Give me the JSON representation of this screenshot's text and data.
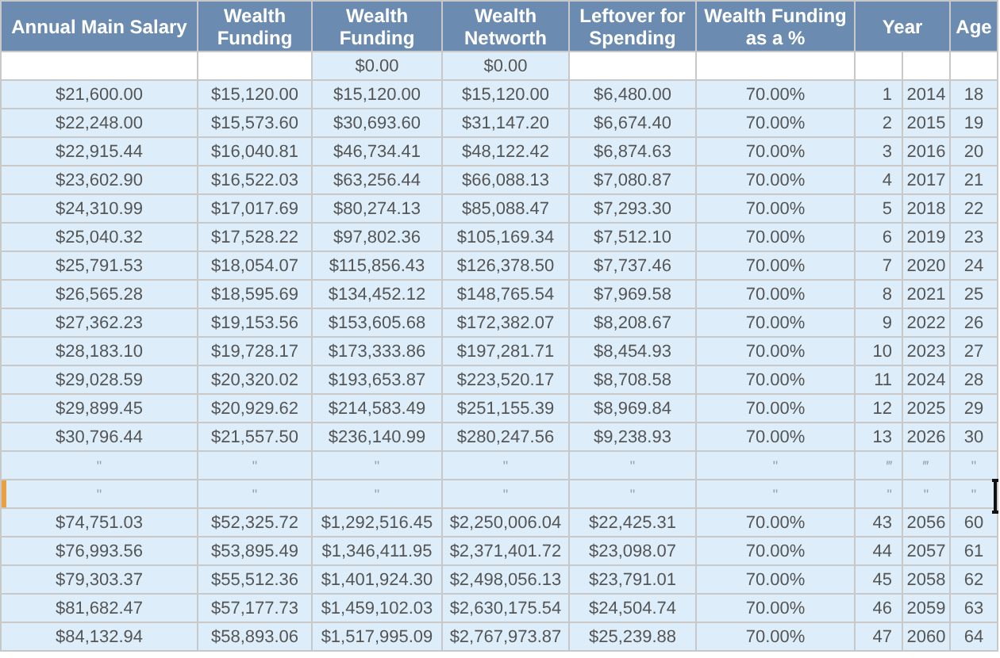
{
  "columns": [
    {
      "label": "Annual Main Salary",
      "kind": "single"
    },
    {
      "label": "Wealth Funding",
      "kind": "single"
    },
    {
      "label": "Wealth Funding",
      "kind": "single"
    },
    {
      "label": "Wealth Networth",
      "kind": "single"
    },
    {
      "label": "Leftover for Spending",
      "kind": "single"
    },
    {
      "label": "Wealth Funding as a %",
      "kind": "single"
    },
    {
      "label": "Year",
      "kind": "double"
    },
    {
      "label": "Age",
      "kind": "single"
    }
  ],
  "opening": {
    "wealth_funding": "$0.00",
    "wealth_networth": "$0.00"
  },
  "rows": [
    {
      "kind": "data",
      "selected": false,
      "cells": [
        "$21,600.00",
        "$15,120.00",
        "$15,120.00",
        "$15,120.00",
        "$6,480.00",
        "70.00%",
        "1",
        "2014",
        "18"
      ]
    },
    {
      "kind": "data",
      "selected": false,
      "cells": [
        "$22,248.00",
        "$15,573.60",
        "$30,693.60",
        "$31,147.20",
        "$6,674.40",
        "70.00%",
        "2",
        "2015",
        "19"
      ]
    },
    {
      "kind": "data",
      "selected": false,
      "cells": [
        "$22,915.44",
        "$16,040.81",
        "$46,734.41",
        "$48,122.42",
        "$6,874.63",
        "70.00%",
        "3",
        "2016",
        "20"
      ]
    },
    {
      "kind": "data",
      "selected": false,
      "cells": [
        "$23,602.90",
        "$16,522.03",
        "$63,256.44",
        "$66,088.13",
        "$7,080.87",
        "70.00%",
        "4",
        "2017",
        "21"
      ]
    },
    {
      "kind": "data",
      "selected": false,
      "cells": [
        "$24,310.99",
        "$17,017.69",
        "$80,274.13",
        "$85,088.47",
        "$7,293.30",
        "70.00%",
        "5",
        "2018",
        "22"
      ]
    },
    {
      "kind": "data",
      "selected": false,
      "cells": [
        "$25,040.32",
        "$17,528.22",
        "$97,802.36",
        "$105,169.34",
        "$7,512.10",
        "70.00%",
        "6",
        "2019",
        "23"
      ]
    },
    {
      "kind": "data",
      "selected": false,
      "cells": [
        "$25,791.53",
        "$18,054.07",
        "$115,856.43",
        "$126,378.50",
        "$7,737.46",
        "70.00%",
        "7",
        "2020",
        "24"
      ]
    },
    {
      "kind": "data",
      "selected": false,
      "cells": [
        "$26,565.28",
        "$18,595.69",
        "$134,452.12",
        "$148,765.54",
        "$7,969.58",
        "70.00%",
        "8",
        "2021",
        "25"
      ]
    },
    {
      "kind": "data",
      "selected": false,
      "cells": [
        "$27,362.23",
        "$19,153.56",
        "$153,605.68",
        "$172,382.07",
        "$8,208.67",
        "70.00%",
        "9",
        "2022",
        "26"
      ]
    },
    {
      "kind": "data",
      "selected": false,
      "cells": [
        "$28,183.10",
        "$19,728.17",
        "$173,333.86",
        "$197,281.71",
        "$8,454.93",
        "70.00%",
        "10",
        "2023",
        "27"
      ]
    },
    {
      "kind": "data",
      "selected": false,
      "cells": [
        "$29,028.59",
        "$20,320.02",
        "$193,653.87",
        "$223,520.17",
        "$8,708.58",
        "70.00%",
        "11",
        "2024",
        "28"
      ]
    },
    {
      "kind": "data",
      "selected": false,
      "cells": [
        "$29,899.45",
        "$20,929.62",
        "$214,583.49",
        "$251,155.39",
        "$8,969.84",
        "70.00%",
        "12",
        "2025",
        "29"
      ]
    },
    {
      "kind": "data",
      "selected": false,
      "cells": [
        "$30,796.44",
        "$21,557.50",
        "$236,140.99",
        "$280,247.56",
        "$9,238.93",
        "70.00%",
        "13",
        "2026",
        "30"
      ]
    },
    {
      "kind": "ditto",
      "selected": false,
      "cells": [
        "\"",
        "\"",
        "\"",
        "\"",
        "\"",
        "\"",
        "‴",
        "‴",
        "\""
      ]
    },
    {
      "kind": "ditto",
      "selected": true,
      "cells": [
        "\"",
        "\"",
        "\"",
        "\"",
        "\"",
        "\"",
        "\"",
        "\"",
        "\""
      ]
    },
    {
      "kind": "data",
      "selected": false,
      "cells": [
        "$74,751.03",
        "$52,325.72",
        "$1,292,516.45",
        "$2,250,006.04",
        "$22,425.31",
        "70.00%",
        "43",
        "2056",
        "60"
      ]
    },
    {
      "kind": "data",
      "selected": false,
      "cells": [
        "$76,993.56",
        "$53,895.49",
        "$1,346,411.95",
        "$2,371,401.72",
        "$23,098.07",
        "70.00%",
        "44",
        "2057",
        "61"
      ]
    },
    {
      "kind": "data",
      "selected": false,
      "cells": [
        "$79,303.37",
        "$55,512.36",
        "$1,401,924.30",
        "$2,498,056.13",
        "$23,791.01",
        "70.00%",
        "45",
        "2058",
        "62"
      ]
    },
    {
      "kind": "data",
      "selected": false,
      "cells": [
        "$81,682.47",
        "$57,177.73",
        "$1,459,102.03",
        "$2,630,175.54",
        "$24,504.74",
        "70.00%",
        "46",
        "2059",
        "63"
      ]
    },
    {
      "kind": "data",
      "selected": false,
      "cells": [
        "$84,132.94",
        "$58,893.06",
        "$1,517,995.09",
        "$2,767,973.87",
        "$25,239.88",
        "70.00%",
        "47",
        "2060",
        "64"
      ]
    }
  ]
}
